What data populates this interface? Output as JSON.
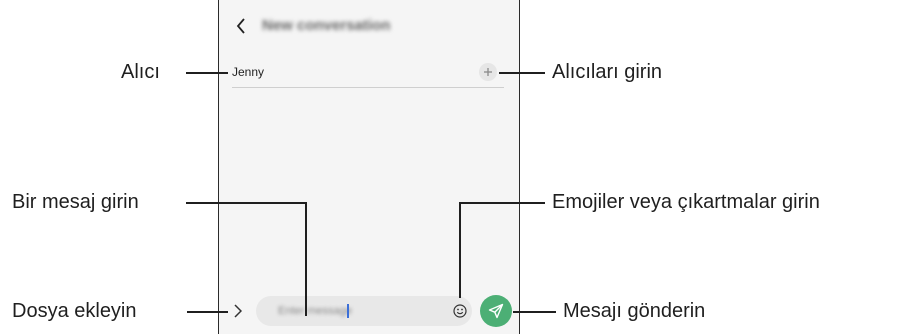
{
  "conversation": {
    "title": "New conversation",
    "recipient": "Jenny",
    "message_placeholder": "Enter message"
  },
  "callouts": {
    "recipient": "Alıcı",
    "add_recipients": "Alıcıları girin",
    "enter_message": "Bir mesaj girin",
    "emoji_stickers": "Emojiler veya çıkartmalar girin",
    "attach_file": "Dosya ekleyin",
    "send_message": "Mesajı gönderin"
  },
  "icons": {
    "back": "chevron-left-icon",
    "add": "plus-icon",
    "attach": "chevron-right-icon",
    "emoji": "smiley-icon",
    "send": "paper-plane-icon"
  },
  "colors": {
    "send_button": "#4caf75",
    "screen_background": "#f5f5f5",
    "input_background": "#e8e8e8"
  }
}
